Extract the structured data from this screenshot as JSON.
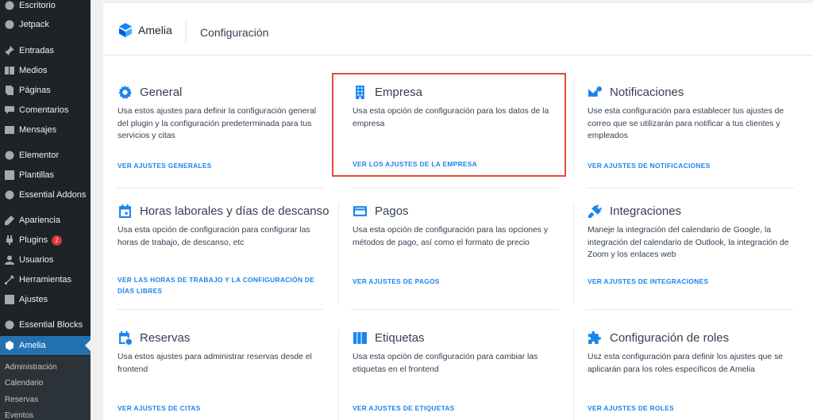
{
  "sidebar": {
    "items": [
      {
        "label": "Escritorio",
        "icon": "dashboard-icon",
        "badge": ""
      },
      {
        "label": "Jetpack",
        "icon": "jetpack-icon",
        "badge": ""
      },
      {
        "label": "Entradas",
        "icon": "pin-icon",
        "badge": ""
      },
      {
        "label": "Medios",
        "icon": "media-icon",
        "badge": ""
      },
      {
        "label": "Páginas",
        "icon": "pages-icon",
        "badge": ""
      },
      {
        "label": "Comentarios",
        "icon": "comments-icon",
        "badge": ""
      },
      {
        "label": "Mensajes",
        "icon": "messages-icon",
        "badge": ""
      },
      {
        "label": "Elementor",
        "icon": "elementor-icon",
        "badge": ""
      },
      {
        "label": "Plantillas",
        "icon": "templates-icon",
        "badge": ""
      },
      {
        "label": "Essential Addons",
        "icon": "essential-addons-icon",
        "badge": ""
      },
      {
        "label": "Apariencia",
        "icon": "appearance-icon",
        "badge": ""
      },
      {
        "label": "Plugins",
        "icon": "plugins-icon",
        "badge": "2"
      },
      {
        "label": "Usuarios",
        "icon": "users-icon",
        "badge": ""
      },
      {
        "label": "Herramientas",
        "icon": "tools-icon",
        "badge": ""
      },
      {
        "label": "Ajustes",
        "icon": "settings-icon",
        "badge": ""
      },
      {
        "label": "Essential Blocks",
        "icon": "essential-blocks-icon",
        "badge": ""
      },
      {
        "label": "Amelia",
        "icon": "amelia-icon",
        "badge": ""
      }
    ],
    "submenu": [
      "Administración",
      "Calendario",
      "Reservas",
      "Eventos"
    ]
  },
  "header": {
    "brand": "Amelia",
    "title": "Configuración"
  },
  "cards": [
    {
      "title": "General",
      "icon": "gear-icon",
      "description": "Usa estos ajustes para definir la configuración general del plugin y la configuración predeterminada para tus servicios y citas",
      "link": "VER AJUSTES GENERALES"
    },
    {
      "title": "Empresa",
      "icon": "building-icon",
      "description": "Usa esta opción de configuración para los datos de la empresa",
      "link": "VER LOS AJUSTES DE LA EMPRESA"
    },
    {
      "title": "Notificaciones",
      "icon": "email-notification-icon",
      "description": "Use esta configuración para establecer tus ajustes de correo que se utilizarán para notificar a tus clientes y empleados",
      "link": "VER AJUSTES DE NOTIFICACIONES"
    },
    {
      "title": "Horas laborales y días de descanso",
      "icon": "calendar-icon",
      "description": "Usa esta opción de configuración para configurar las horas de trabajo, de descanso, etc",
      "link": "VER LAS HORAS DE TRABAJO Y LA CONFIGURACIÓN DE DÍAS LIBRES"
    },
    {
      "title": "Pagos",
      "icon": "credit-card-icon",
      "description": "Usa esta opción de configuración para las opciones y métodos de pago, así como el formato de precio",
      "link": "VER AJUSTES DE PAGOS"
    },
    {
      "title": "Integraciones",
      "icon": "plug-icon",
      "description": "Maneje la integración del calendario de Google, la integración del calendario de Outlook, la integración de Zoom y los enlaces web",
      "link": "VER AJUSTES DE INTEGRACIONES"
    },
    {
      "title": "Reservas",
      "icon": "calendar-clock-icon",
      "description": "Usa estos ajustes para administrar reservas desde el frontend",
      "link": "VER AJUSTES DE CITAS"
    },
    {
      "title": "Etiquetas",
      "icon": "books-icon",
      "description": "Usa esta opción de configuración para cambiar las etiquetas en el frontend",
      "link": "VER AJUSTES DE ETIQUETAS"
    },
    {
      "title": "Configuración de roles",
      "icon": "puzzle-icon",
      "description": "Usz esta configuración para definir los ajustes que se aplicarán para los roles específicos de Amelia",
      "link": "VER AJUSTES DE ROLES"
    }
  ],
  "colors": {
    "accent": "#1a84ee",
    "sidebar_bg": "#1d2327",
    "sidebar_active": "#2271b1",
    "highlight_border": "#e34b3c"
  }
}
